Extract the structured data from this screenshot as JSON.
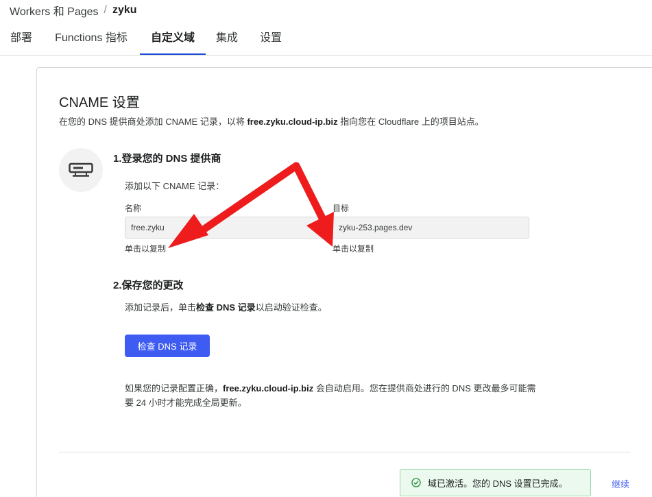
{
  "breadcrumb": {
    "root": "Workers 和 Pages",
    "separator": "/",
    "current": "zyku"
  },
  "tabs": [
    {
      "label": "部署",
      "active": false
    },
    {
      "label": "Functions 指标",
      "active": false
    },
    {
      "label": "自定义域",
      "active": true
    },
    {
      "label": "集成",
      "active": false
    },
    {
      "label": "设置",
      "active": false
    }
  ],
  "cname": {
    "title": "CNAME 设置",
    "desc_pre": "在您的 DNS 提供商处添加 CNAME 记录，以将 ",
    "desc_domain": "free.zyku.cloud-ip.biz",
    "desc_post": " 指向您在 Cloudflare 上的项目站点。"
  },
  "step1": {
    "title": "1.登录您的 DNS 提供商",
    "instruction": "添加以下 CNAME 记录：",
    "name_label": "名称",
    "name_value": "free.zyku",
    "target_label": "目标",
    "target_value": "zyku-253.pages.dev",
    "copy_hint": "单击以复制"
  },
  "step2": {
    "title": "2.保存您的更改",
    "instruction_pre": "添加记录后，单击",
    "instruction_bold": "检查 DNS 记录",
    "instruction_post": "以启动验证检查。",
    "button_label": "检查 DNS 记录"
  },
  "note": {
    "pre": "如果您的记录配置正确，",
    "domain": "free.zyku.cloud-ip.biz",
    "post": " 会自动启用。您在提供商处进行的 DNS 更改最多可能需要 24 小时才能完成全局更新。"
  },
  "toast": {
    "text": "域已激活。您的 DNS 设置已完成。",
    "icon": "check-circle-icon"
  },
  "footer": {
    "continue_label": "继续"
  },
  "colors": {
    "primary": "#3e5bf2",
    "success_bg": "#ecf9ef",
    "success_border": "#9bd6a8",
    "annotation_arrow": "#ee1c1c"
  }
}
